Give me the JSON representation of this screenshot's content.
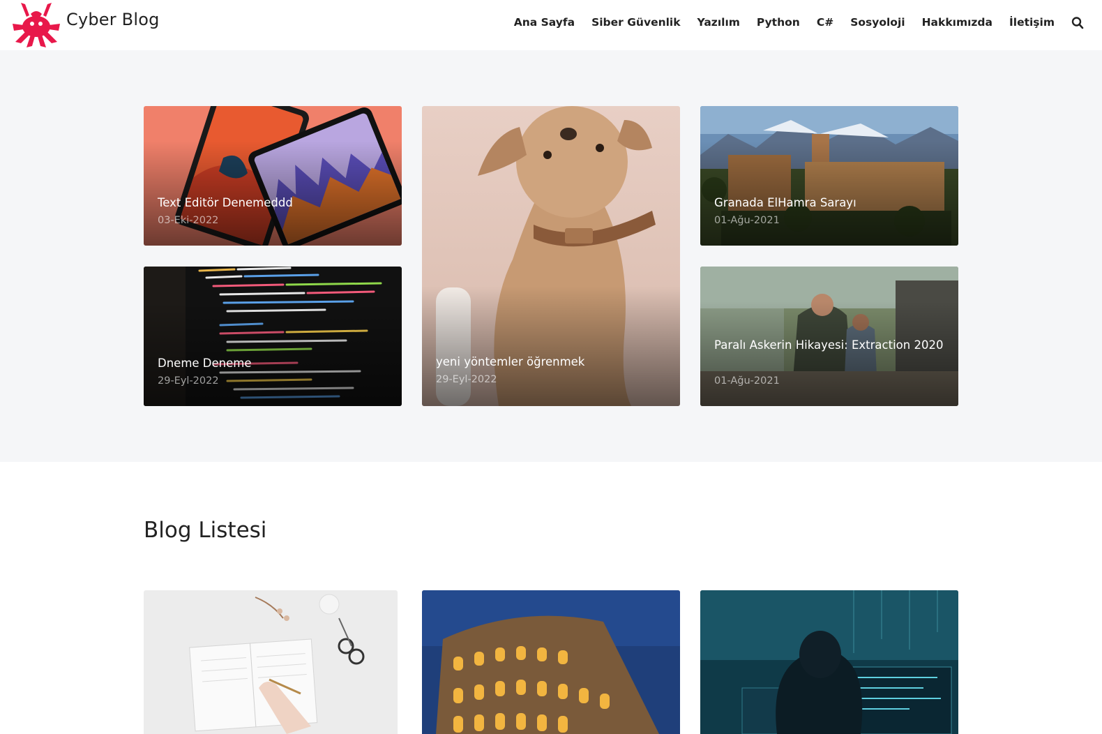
{
  "header": {
    "brand": "Cyber Blog",
    "logo_icon": "spider-icon",
    "accent": "#e8184a",
    "nav": [
      "Ana Sayfa",
      "Siber Güvenlik",
      "Yazılım",
      "Python",
      "C#",
      "Sosyoloji",
      "Hakkımızda",
      "İletişim"
    ],
    "search_icon": "search-icon"
  },
  "featured": [
    {
      "title": "Text Editör Denemeddd",
      "date": "03-Eki-2022"
    },
    {
      "title": "yeni yöntemler öğrenmek",
      "date": "29-Eyl-2022"
    },
    {
      "title": "Granada ElHamra Sarayı",
      "date": "01-Ağu-2021"
    },
    {
      "title": "Dneme Deneme",
      "date": "29-Eyl-2022"
    },
    {
      "title": "Paralı Askerin Hikayesi: Extraction 2020",
      "date": "01-Ağu-2021"
    }
  ],
  "blog_list": {
    "title": "Blog Listesi"
  }
}
